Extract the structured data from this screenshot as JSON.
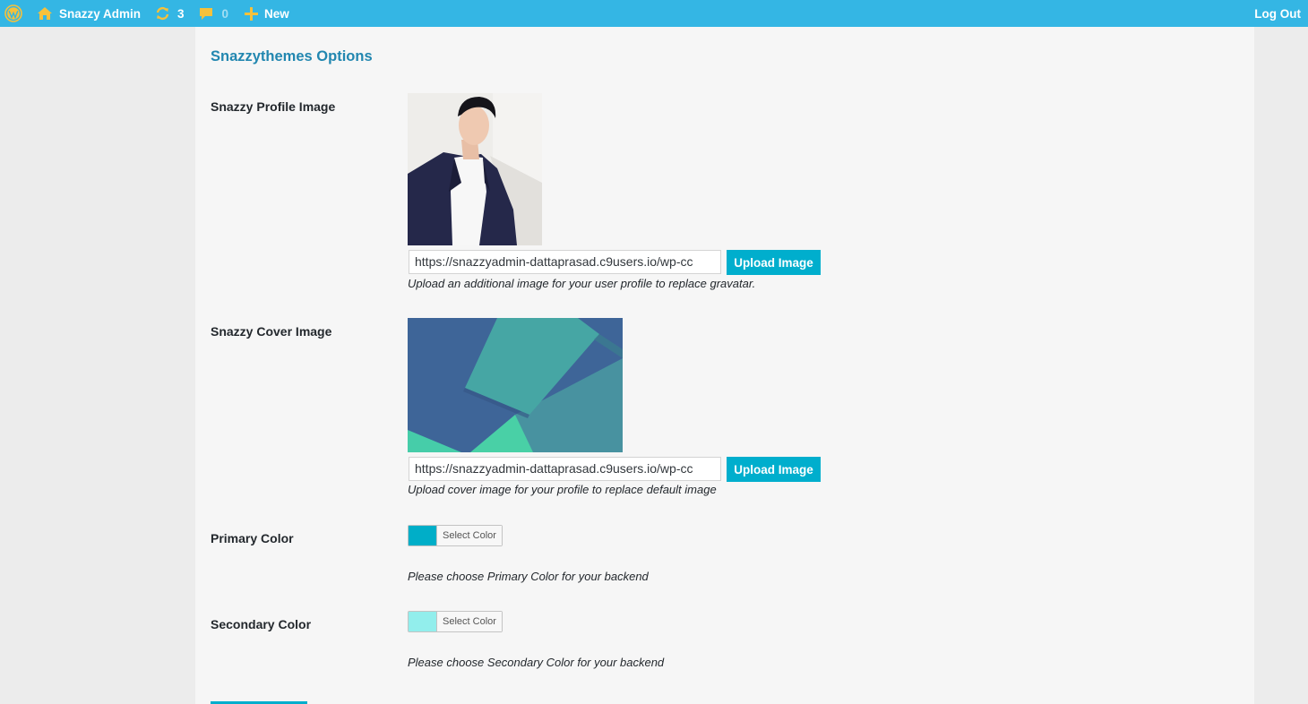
{
  "adminbar": {
    "site_name": "Snazzy Admin",
    "updates_count": "3",
    "comments_count": "0",
    "new_label": "New",
    "logout_label": "Log Out",
    "icons": {
      "wordpress": "wordpress-logo-icon",
      "home": "home-icon",
      "updates": "refresh-icon",
      "comments": "comment-bubble-icon",
      "new": "plus-icon"
    },
    "colors": {
      "bar": "#34b6e4",
      "icon": "#f6c13b"
    }
  },
  "page": {
    "title": "Snazzythemes Options",
    "title_color": "#2287b0"
  },
  "profile_image": {
    "label": "Snazzy Profile Image",
    "url_value": "https://snazzyadmin-dattaprasad.c9users.io/wp-cc",
    "button_label": "Upload Image",
    "description": "Upload an additional image for your user profile to replace gravatar."
  },
  "cover_image": {
    "label": "Snazzy Cover Image",
    "url_value": "https://snazzyadmin-dattaprasad.c9users.io/wp-cc",
    "button_label": "Upload Image",
    "description": "Upload cover image for your profile to replace default image"
  },
  "primary_color": {
    "label": "Primary Color",
    "swatch": "#00aec8",
    "button_label": "Select Color",
    "description": "Please choose Primary Color for your backend"
  },
  "secondary_color": {
    "label": "Secondary Color",
    "swatch": "#92eeec",
    "button_label": "Select Color",
    "description": "Please choose Secondary Color for your backend"
  },
  "accent_color": "#00aecd"
}
